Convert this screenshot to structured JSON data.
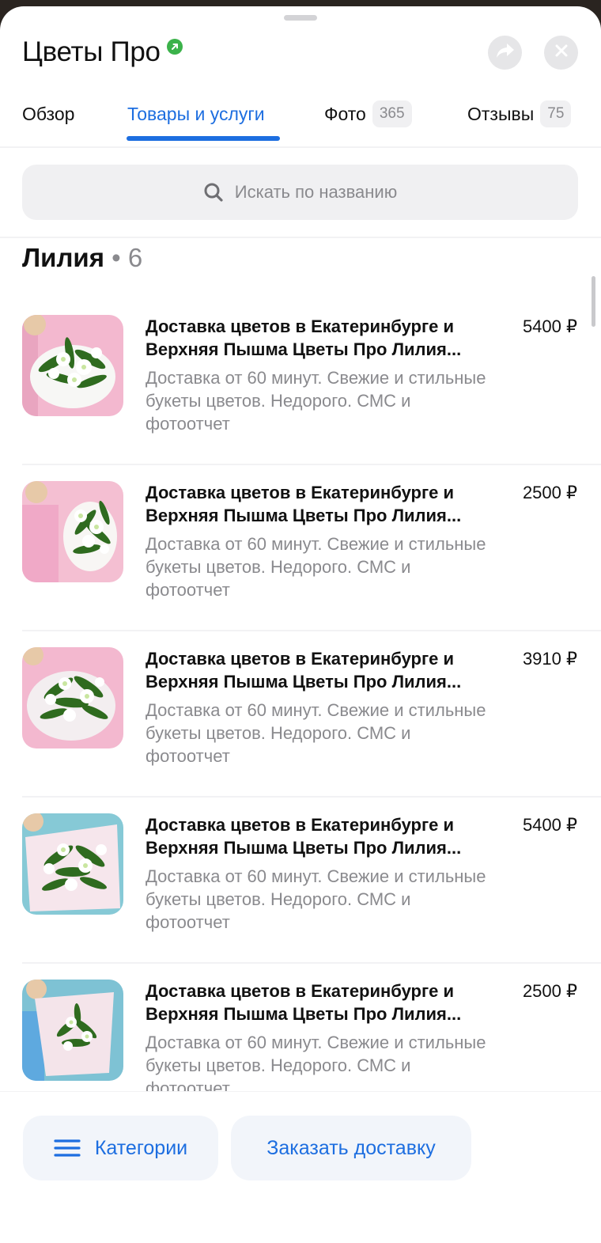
{
  "header": {
    "title": "Цветы Про",
    "verified_icon": "verified-badge-icon",
    "share_icon": "share-arrow-icon",
    "close_icon": "close-icon"
  },
  "tabs": [
    {
      "label": "Обзор",
      "active": false
    },
    {
      "label": "Товары и услуги",
      "active": true
    },
    {
      "label": "Фото",
      "badge": "365",
      "active": false
    },
    {
      "label": "Отзывы",
      "badge": "75",
      "active": false
    }
  ],
  "search": {
    "placeholder": "Искать по названию",
    "icon": "search-icon"
  },
  "section": {
    "title": "Лилия",
    "count": "• 6"
  },
  "items": [
    {
      "title": "Доставка цветов в Екатеринбурге и Верхняя Пышма Цветы Про Лилия...",
      "description": "Доставка от 60 минут. Свежие и стильные букеты цветов. Недорого. СМС и фотоотчет",
      "price": "5400 ₽"
    },
    {
      "title": "Доставка цветов в Екатеринбурге и Верхняя Пышма Цветы Про Лилия...",
      "description": "Доставка от 60 минут. Свежие и стильные букеты цветов. Недорого. СМС и фотоотчет",
      "price": "2500 ₽"
    },
    {
      "title": "Доставка цветов в Екатеринбурге и Верхняя Пышма Цветы Про Лилия...",
      "description": "Доставка от 60 минут. Свежие и стильные букеты цветов. Недорого. СМС и фотоотчет",
      "price": "3910 ₽"
    },
    {
      "title": "Доставка цветов в Екатеринбурге и Верхняя Пышма Цветы Про Лилия...",
      "description": "Доставка от 60 минут. Свежие и стильные букеты цветов. Недорого. СМС и фотоотчет",
      "price": "5400 ₽"
    },
    {
      "title": "Доставка цветов в Екатеринбурге и Верхняя Пышма Цветы Про Лилия...",
      "description": "Доставка от 60 минут. Свежие и стильные букеты цветов. Недорого. СМС и фотоотчет",
      "price": "2500 ₽"
    }
  ],
  "bottom": {
    "categories_label": "Категории",
    "delivery_label": "Заказать доставку"
  },
  "colors": {
    "accent": "#1d6ee0",
    "verified": "#3bb24a",
    "muted_text": "#8a8a8e",
    "thumb_pink": "#f3b8cf",
    "thumb_blue": "#86c9d6"
  }
}
